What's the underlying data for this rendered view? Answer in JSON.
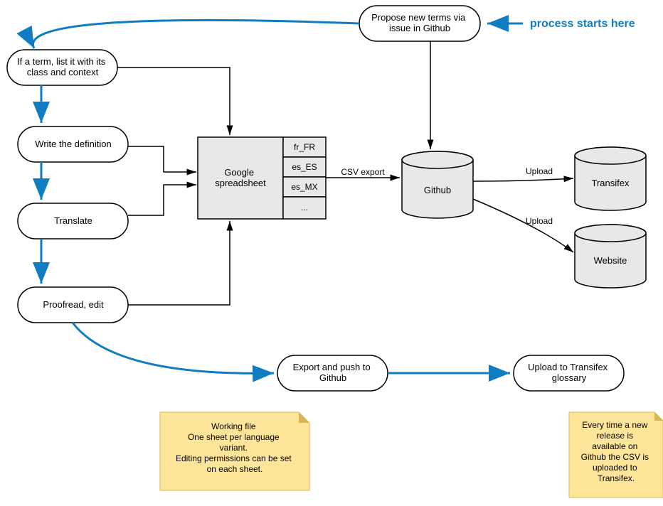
{
  "start_label": "process starts here",
  "nodes": {
    "propose": "Propose new terms via\nissue in Github",
    "ifterm": "If a term, list it with its\nclass and context",
    "writedef": "Write the definition",
    "translate": "Translate",
    "proofread": "Proofread, edit",
    "export": "Export and push to\nGithub",
    "upload_glossary": "Upload to Transifex\nglossary",
    "spreadsheet": "Google\nspreadsheet",
    "github": "Github",
    "transifex": "Transifex",
    "website": "Website"
  },
  "locales": [
    "fr_FR",
    "es_ES",
    "es_MX",
    "..."
  ],
  "edge_labels": {
    "csv_export": "CSV export",
    "upload1": "Upload",
    "upload2": "Upload"
  },
  "notes": {
    "working_file": "Working file\nOne sheet per language\nvariant.\nEditing permissions can be set\non each sheet.",
    "release": "Every time a new\nrelease is\navailable on\nGithub the CSV is\nuploaded to\nTransifex."
  },
  "chart_data": {
    "type": "flowchart",
    "nodes": [
      {
        "id": "propose",
        "label": "Propose new terms via issue in Github",
        "shape": "start-end"
      },
      {
        "id": "ifterm",
        "label": "If a term, list it with its class and context",
        "shape": "start-end"
      },
      {
        "id": "writedef",
        "label": "Write the definition",
        "shape": "start-end"
      },
      {
        "id": "translate",
        "label": "Translate",
        "shape": "start-end"
      },
      {
        "id": "proofread",
        "label": "Proofread, edit",
        "shape": "start-end"
      },
      {
        "id": "spreadsheet",
        "label": "Google spreadsheet",
        "shape": "process",
        "sublist": [
          "fr_FR",
          "es_ES",
          "es_MX",
          "..."
        ]
      },
      {
        "id": "github",
        "label": "Github",
        "shape": "datastore"
      },
      {
        "id": "transifex",
        "label": "Transifex",
        "shape": "datastore"
      },
      {
        "id": "website",
        "label": "Website",
        "shape": "datastore"
      },
      {
        "id": "export",
        "label": "Export and push to Github",
        "shape": "start-end"
      },
      {
        "id": "upload_glossary",
        "label": "Upload to Transifex glossary",
        "shape": "start-end"
      }
    ],
    "edges": [
      {
        "from": "start",
        "to": "propose",
        "style": "highlight"
      },
      {
        "from": "propose",
        "to": "ifterm",
        "style": "highlight"
      },
      {
        "from": "ifterm",
        "to": "writedef",
        "style": "highlight"
      },
      {
        "from": "writedef",
        "to": "translate",
        "style": "highlight"
      },
      {
        "from": "translate",
        "to": "proofread",
        "style": "highlight"
      },
      {
        "from": "proofread",
        "to": "export",
        "style": "highlight"
      },
      {
        "from": "export",
        "to": "upload_glossary",
        "style": "highlight"
      },
      {
        "from": "ifterm",
        "to": "spreadsheet"
      },
      {
        "from": "writedef",
        "to": "spreadsheet"
      },
      {
        "from": "translate",
        "to": "spreadsheet"
      },
      {
        "from": "proofread",
        "to": "spreadsheet"
      },
      {
        "from": "spreadsheet",
        "to": "github",
        "label": "CSV export"
      },
      {
        "from": "propose",
        "to": "github"
      },
      {
        "from": "github",
        "to": "transifex",
        "label": "Upload"
      },
      {
        "from": "github",
        "to": "website",
        "label": "Upload"
      }
    ],
    "annotations": [
      {
        "text": "process starts here",
        "points_to": "propose"
      },
      {
        "text": "Working file. One sheet per language variant. Editing permissions can be set on each sheet.",
        "type": "note",
        "near": "spreadsheet"
      },
      {
        "text": "Every time a new release is available on Github the CSV is uploaded to Transifex.",
        "type": "note",
        "near": "upload_glossary"
      }
    ]
  }
}
